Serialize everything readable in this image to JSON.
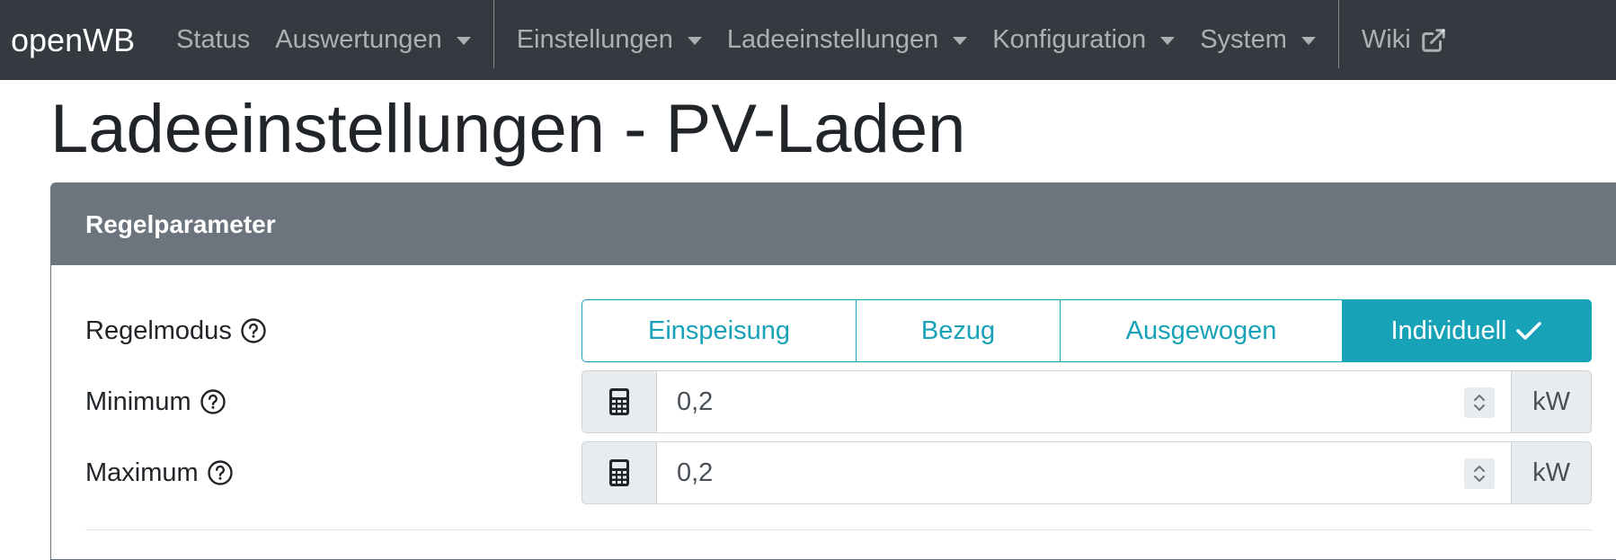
{
  "navbar": {
    "brand": "openWB",
    "items": [
      {
        "label": "Status",
        "dropdown": false
      },
      {
        "label": "Auswertungen",
        "dropdown": true
      },
      {
        "label": "Einstellungen",
        "dropdown": true
      },
      {
        "label": "Ladeeinstellungen",
        "dropdown": true
      },
      {
        "label": "Konfiguration",
        "dropdown": true
      },
      {
        "label": "System",
        "dropdown": true
      },
      {
        "label": "Wiki",
        "dropdown": false,
        "external": true
      }
    ]
  },
  "page": {
    "title": "Ladeeinstellungen - PV-Laden"
  },
  "card": {
    "header": "Regelparameter",
    "regelmodus": {
      "label": "Regelmodus",
      "options": [
        "Einspeisung",
        "Bezug",
        "Ausgewogen",
        "Individuell"
      ],
      "selected": "Individuell"
    },
    "minimum": {
      "label": "Minimum",
      "value": "0,2",
      "unit": "kW"
    },
    "maximum": {
      "label": "Maximum",
      "value": "0,2",
      "unit": "kW"
    }
  },
  "icons": {
    "help": "question-circle-icon",
    "calculator": "calculator-icon",
    "external_link": "external-link-icon",
    "check": "check-icon",
    "spinner": "chevron-up-down-icon"
  },
  "colors": {
    "navbar_bg": "#343a40",
    "card_header_bg": "#6c757d",
    "accent": "#17a2b8"
  }
}
